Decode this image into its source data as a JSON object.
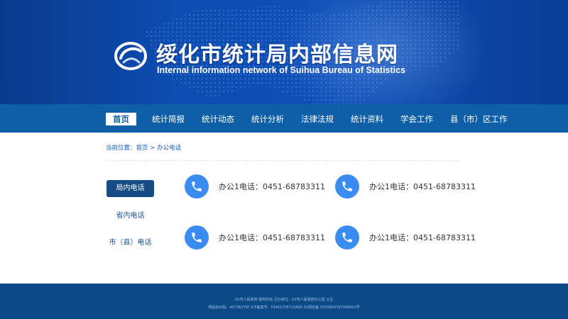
{
  "header": {
    "title_cn": "绥化市统计局内部信息网",
    "title_en": "Internal information network of Suihua Bureau of Statistics"
  },
  "nav": {
    "items": [
      "首页",
      "统计简报",
      "统计动态",
      "统计分析",
      "法律法规",
      "统计资料",
      "学会工作",
      "县（市）区工作"
    ],
    "active_index": 0
  },
  "breadcrumb": {
    "prefix": "当前位置：",
    "home": "首页",
    "separator": " > ",
    "current": "办公电话"
  },
  "sidebar": {
    "items": [
      "局内电话",
      "省内电话",
      "市（县）电话"
    ],
    "active_index": 0
  },
  "phones": [
    {
      "icon": "phone-icon",
      "label": "办公1电话：0451-68783311"
    },
    {
      "icon": "phone-icon",
      "label": "办公1电话：0451-68783311"
    },
    {
      "icon": "phone-icon",
      "label": "办公1电话：0451-68783311"
    },
    {
      "icon": "phone-icon",
      "label": "办公1电话：0451-68783311"
    }
  ],
  "footer": {
    "line1": "XX市人民政府 版权所有    主办单位：XX市人民政府办公室 公主",
    "line2": "网站标识码：457361797  ICP备案号：F0451736723456  XX网安备 5470604797390001号"
  },
  "colors": {
    "banner": "#0d4cb0",
    "nav": "#0f5fa8",
    "sidebar_active": "#154c86",
    "phone_circle": "#3a8cf0",
    "footer": "#0b4a86"
  }
}
